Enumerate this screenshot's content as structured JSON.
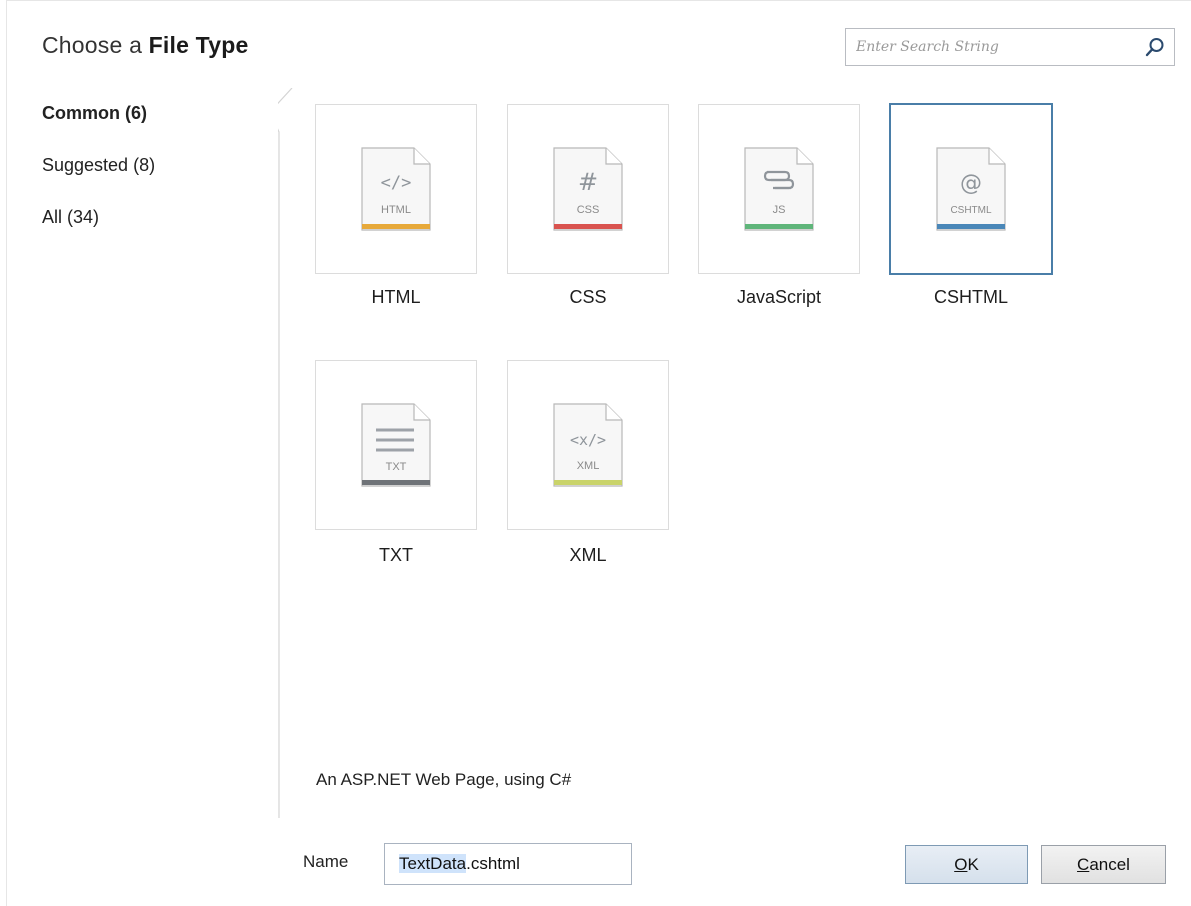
{
  "title": {
    "prefix": "Choose a",
    "bold": "File Type"
  },
  "search": {
    "placeholder": "Enter Search String",
    "value": ""
  },
  "categories": [
    {
      "label": "Common (6)",
      "selected": true
    },
    {
      "label": "Suggested (8)",
      "selected": false
    },
    {
      "label": "All (34)",
      "selected": false
    }
  ],
  "file_types": [
    {
      "label": "HTML",
      "icon_text": "HTML",
      "glyph": "</>",
      "accent": "#e7a93a",
      "selected": false
    },
    {
      "label": "CSS",
      "icon_text": "CSS",
      "glyph": "#",
      "accent": "#d9534f",
      "selected": false
    },
    {
      "label": "JavaScript",
      "icon_text": "JS",
      "glyph": "scroll",
      "accent": "#5fb57a",
      "selected": false
    },
    {
      "label": "CSHTML",
      "icon_text": "CSHTML",
      "glyph": "@",
      "accent": "#4a87b8",
      "selected": true
    },
    {
      "label": "TXT",
      "icon_text": "TXT",
      "glyph": "lines",
      "accent": "#6f7378",
      "selected": false
    },
    {
      "label": "XML",
      "icon_text": "XML",
      "glyph": "<x/>",
      "accent": "#c9d36a",
      "selected": false
    }
  ],
  "description": "An ASP.NET Web Page, using C#",
  "name_field": {
    "label": "Name",
    "selected_part": "TextData",
    "rest": ".cshtml"
  },
  "buttons": {
    "ok_mnemonic": "O",
    "ok_rest": "K",
    "cancel_mnemonic": "C",
    "cancel_rest": "ancel"
  },
  "colors": {
    "selection_border": "#4a7ea8",
    "text_selection": "#cfe3fb"
  }
}
